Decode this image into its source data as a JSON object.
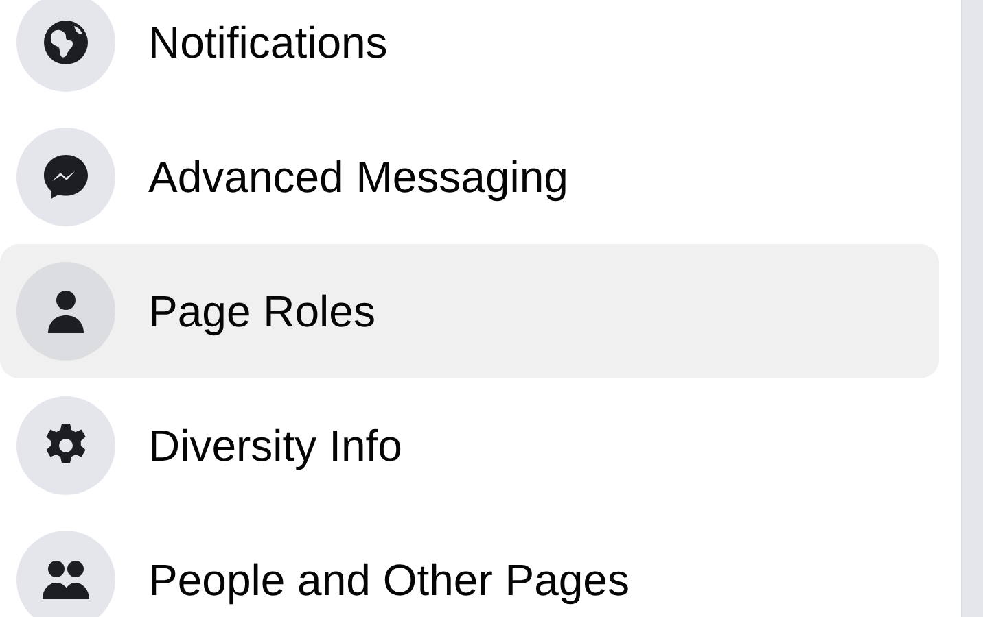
{
  "menu": [
    {
      "label": "Notifications",
      "selected": false
    },
    {
      "label": "Advanced Messaging",
      "selected": false
    },
    {
      "label": "Page Roles",
      "selected": true
    },
    {
      "label": "Diversity Info",
      "selected": false
    },
    {
      "label": "People and Other Pages",
      "selected": false
    }
  ]
}
